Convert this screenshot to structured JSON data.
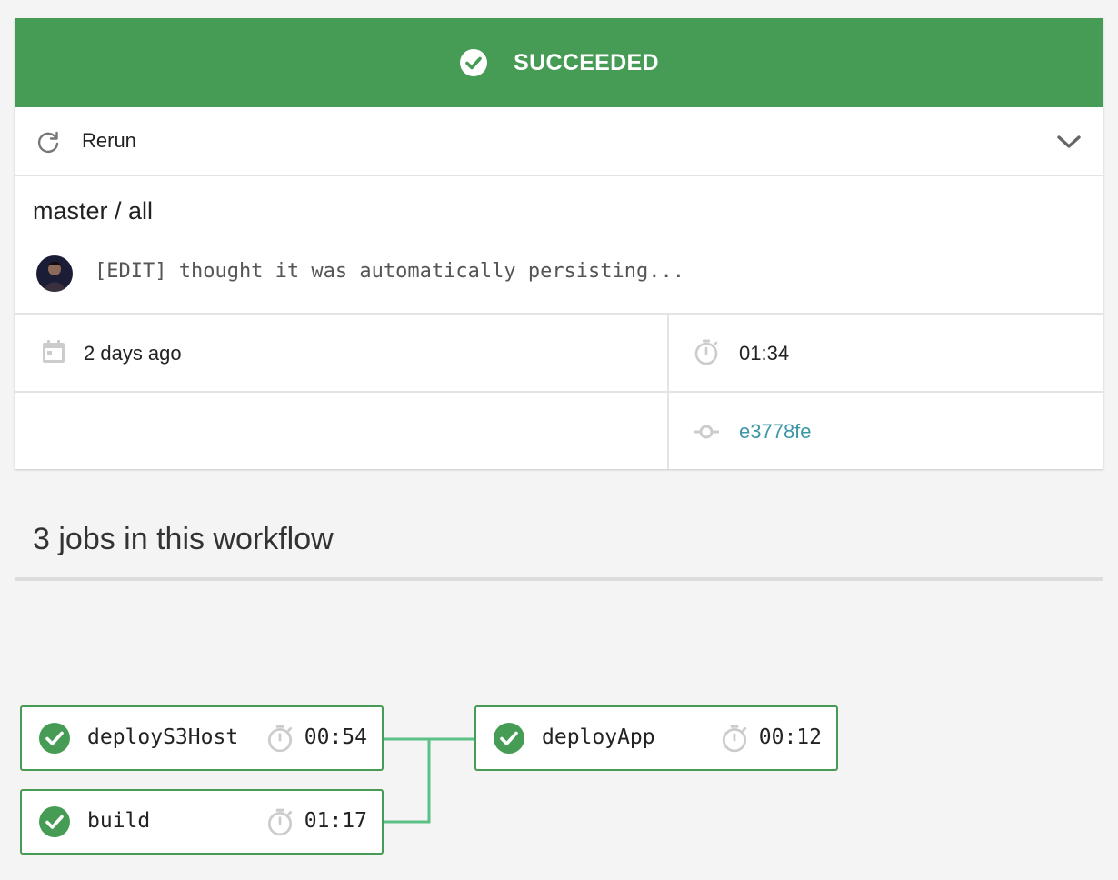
{
  "status": {
    "label": "SUCCEEDED",
    "color": "#469b55",
    "icon": "check-circle-icon"
  },
  "rerun": {
    "label": "Rerun",
    "icon": "refresh-icon",
    "menu_icon": "chevron-down-icon"
  },
  "workflow": {
    "branch_label": "master / all",
    "commit_message": "[EDIT] thought it was automatically persisting...",
    "avatar_icon": "user-avatar",
    "started": "2 days ago",
    "duration": "01:34",
    "commit_sha": "e3778fe",
    "link_color": "#3d97a6"
  },
  "jobs_section": {
    "title": "3 jobs in this workflow",
    "jobs": [
      {
        "name": "deployS3Host",
        "duration": "00:54",
        "status": "success"
      },
      {
        "name": "build",
        "duration": "01:17",
        "status": "success"
      },
      {
        "name": "deployApp",
        "duration": "00:12",
        "status": "success"
      }
    ],
    "connector_color": "#5bc085"
  }
}
